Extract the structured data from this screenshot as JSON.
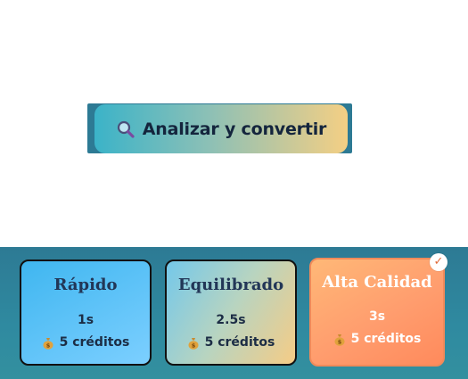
{
  "action": {
    "analyze_label": "Analizar y convertir",
    "icon": "magnifier-icon"
  },
  "quality_options": [
    {
      "title": "Rápido",
      "time": "1s",
      "credits": "5 créditos",
      "selected": false
    },
    {
      "title": "Equilibrado",
      "time": "2.5s",
      "credits": "5 créditos",
      "selected": false
    },
    {
      "title": "Alta Calidad",
      "time": "3s",
      "credits": "5 créditos",
      "selected": true,
      "badge": "✓"
    }
  ],
  "colors": {
    "bar_background": "#2d7a94",
    "title_text": "#223657",
    "selected_card": "#ff9d6e"
  }
}
